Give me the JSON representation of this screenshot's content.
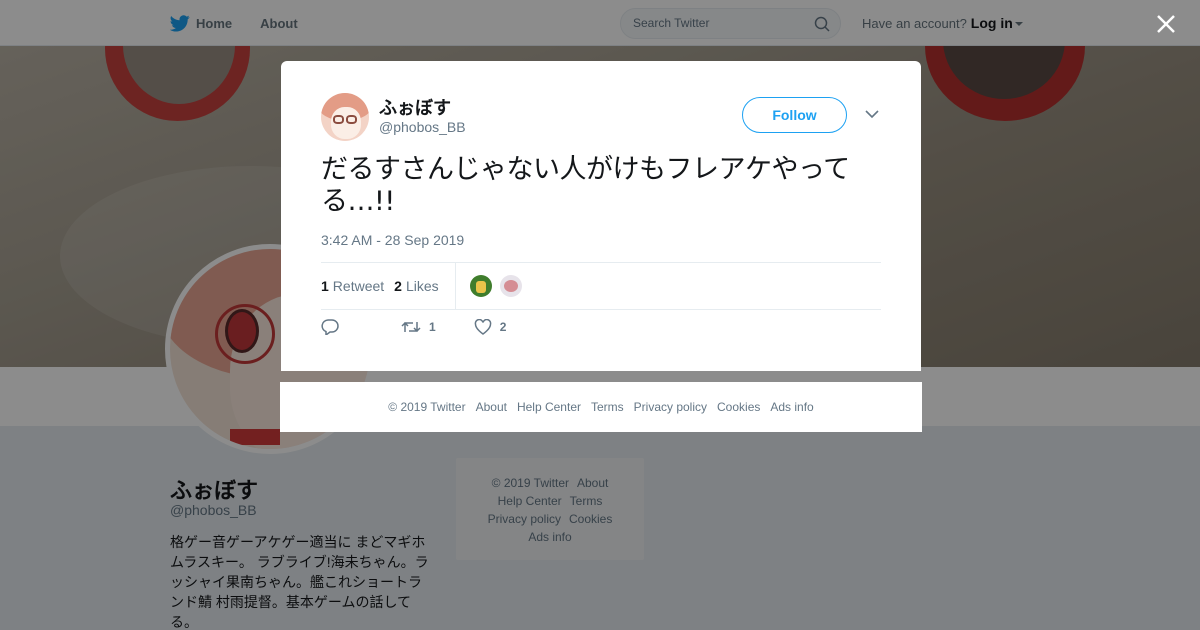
{
  "nav": {
    "home_label": "Home",
    "about_label": "About",
    "search_placeholder": "Search Twitter",
    "account_prompt": "Have an account?",
    "login_label": "Log in"
  },
  "profile": {
    "name": "ふぉぼす",
    "handle": "@phobos_BB",
    "bio": "格ゲー音ゲーアケゲー適当に まどマギホムラスキー。 ラブライブ!海未ちゃん。ラッシャイ果南ちゃん。艦これショートランド鯖 村雨提督。基本ゲームの話してる。"
  },
  "side_footer": {
    "copyright": "© 2019 Twitter",
    "about": "About",
    "help": "Help Center",
    "terms": "Terms",
    "privacy": "Privacy policy",
    "cookies": "Cookies",
    "ads": "Ads info"
  },
  "tweet": {
    "author_name": "ふぉぼす",
    "author_handle": "@phobos_BB",
    "follow_label": "Follow",
    "text": "だるすさんじゃない人がけもフレアケやってる…!!",
    "timestamp": "3:42 AM - 28 Sep 2019",
    "retweet_count": "1",
    "retweet_label": "Retweet",
    "like_count": "2",
    "like_label": "Likes",
    "action_retweet_count": "1",
    "action_like_count": "2"
  },
  "modal_footer": {
    "copyright": "© 2019 Twitter",
    "about": "About",
    "help": "Help Center",
    "terms": "Terms",
    "privacy": "Privacy policy",
    "cookies": "Cookies",
    "ads": "Ads info"
  },
  "colors": {
    "brand": "#1da1f2",
    "text": "#14171a",
    "muted": "#657786"
  }
}
